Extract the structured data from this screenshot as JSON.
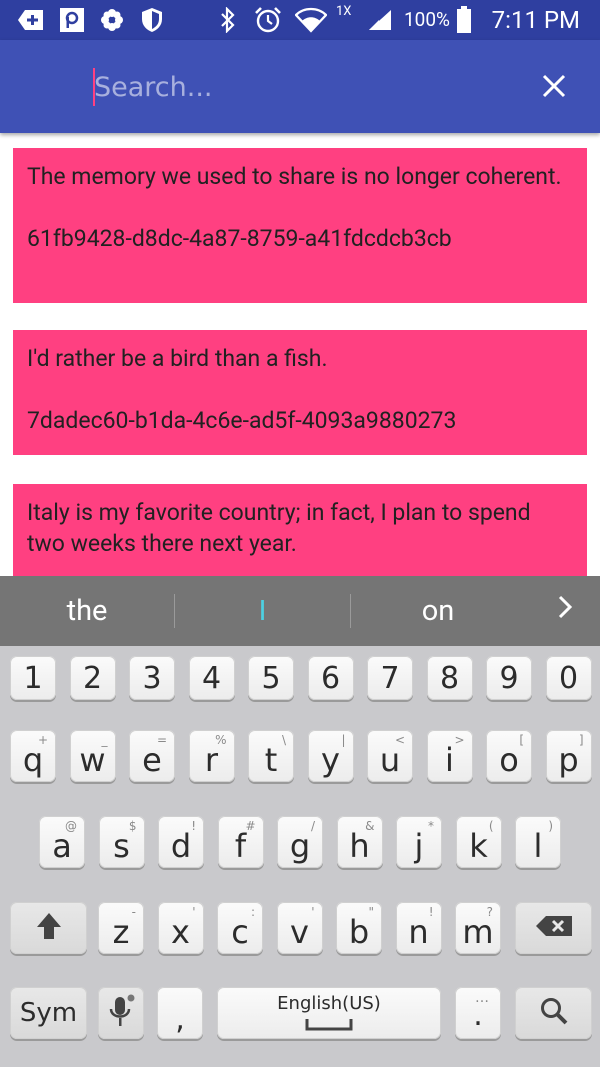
{
  "status_bar": {
    "icons": [
      "add-box-icon",
      "p-app-icon",
      "flower-icon",
      "shield-icon",
      "bluetooth-icon",
      "alarm-icon",
      "wifi-icon",
      "signal-icon",
      "battery-icon"
    ],
    "network_label": "1X",
    "battery_percent": "100%",
    "time": "7:11 PM"
  },
  "app_bar": {
    "search_placeholder": "Search...",
    "search_value": "",
    "close_icon": "close-icon"
  },
  "cards": [
    {
      "text": "The memory we used to share is no longer coherent.",
      "id": "61fb9428-d8dc-4a87-8759-a41fdcdcb3cb"
    },
    {
      "text": "I'd rather be a bird than a fish.",
      "id": "7dadec60-b1da-4c6e-ad5f-4093a9880273"
    },
    {
      "text": "Italy is my favorite country; in fact, I plan to spend two weeks there next year.",
      "id": ""
    }
  ],
  "suggestions": {
    "left": "the",
    "middle": "I",
    "right": "on",
    "more_icon": "chevron-right-icon"
  },
  "keyboard": {
    "number_row": [
      "1",
      "2",
      "3",
      "4",
      "5",
      "6",
      "7",
      "8",
      "9",
      "0"
    ],
    "row1": [
      {
        "k": "q",
        "h": "+"
      },
      {
        "k": "w",
        "h": "_"
      },
      {
        "k": "e",
        "h": "="
      },
      {
        "k": "r",
        "h": "%"
      },
      {
        "k": "t",
        "h": "\\"
      },
      {
        "k": "y",
        "h": "|"
      },
      {
        "k": "u",
        "h": "<"
      },
      {
        "k": "i",
        "h": ">"
      },
      {
        "k": "o",
        "h": "["
      },
      {
        "k": "p",
        "h": "]"
      }
    ],
    "row2": [
      {
        "k": "a",
        "h": "@"
      },
      {
        "k": "s",
        "h": "$"
      },
      {
        "k": "d",
        "h": "!"
      },
      {
        "k": "f",
        "h": "#"
      },
      {
        "k": "g",
        "h": "/"
      },
      {
        "k": "h",
        "h": "&"
      },
      {
        "k": "j",
        "h": "*"
      },
      {
        "k": "k",
        "h": "("
      },
      {
        "k": "l",
        "h": ")"
      }
    ],
    "row3": [
      {
        "k": "z",
        "h": "-"
      },
      {
        "k": "x",
        "h": "'"
      },
      {
        "k": "c",
        "h": ":"
      },
      {
        "k": "v",
        "h": "'"
      },
      {
        "k": "b",
        "h": "\""
      },
      {
        "k": "n",
        "h": "!"
      },
      {
        "k": "m",
        "h": "?"
      }
    ],
    "sym_label": "Sym",
    "comma": ",",
    "space_label": "English(US)",
    "period": ".",
    "period_hint": "…",
    "shift_icon": "shift-arrow-icon",
    "backspace_icon": "backspace-icon",
    "mic_icon": "microphone-icon",
    "search_icon": "search-icon"
  },
  "colors": {
    "status_bar": "#2f3fa0",
    "app_bar": "#3f51b5",
    "card": "#ff4081",
    "suggest_bar": "#757575",
    "keyboard_bg": "#c9c9cc"
  }
}
